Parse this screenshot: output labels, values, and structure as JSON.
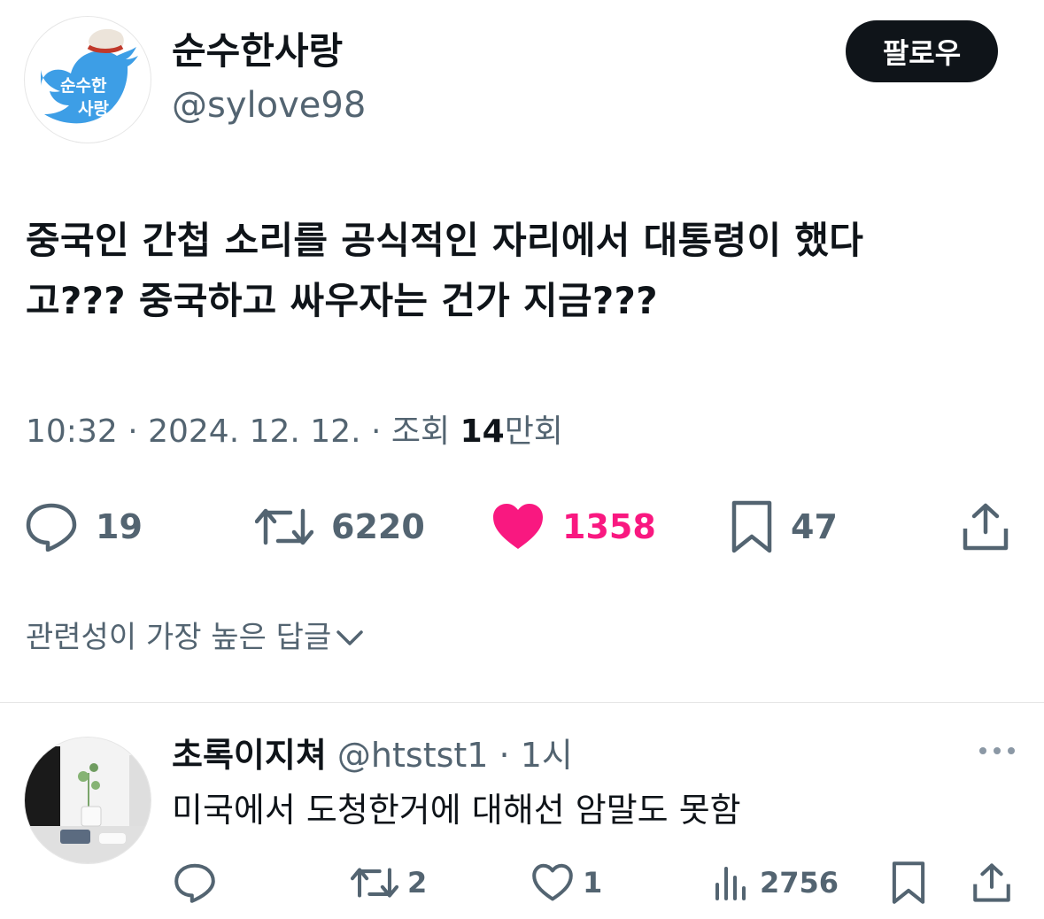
{
  "author": {
    "display_name": "순수한사랑",
    "handle": "@sylove98",
    "avatar_text_top": "순수한",
    "avatar_text_bottom": "사랑"
  },
  "follow_label": "팔로우",
  "tweet": {
    "line1": "중국인 간첩 소리를 공식적인 자리에서 대통령이 했다",
    "line2": "고??? 중국하고 싸우자는 건가 지금???"
  },
  "meta": {
    "time": "10:32",
    "sep1": " · ",
    "date": "2024. 12. 12.",
    "sep2": " · ",
    "views_label": "조회 ",
    "views_value": "14",
    "views_unit": "만회"
  },
  "actions": {
    "replies": "19",
    "retweets": "6220",
    "likes": "1358",
    "bookmarks": "47"
  },
  "sort_label": "관련성이 가장 높은 답글",
  "reply": {
    "name": "초록이지쳐",
    "handle": "@htstst1",
    "time": "1시",
    "sep": " · ",
    "text": "미국에서 도청한거에 대해선 암말도 못함",
    "retweets": "2",
    "likes": "1",
    "views": "2756"
  },
  "colors": {
    "text": "#0f1419",
    "secondary": "#536471",
    "like": "#f91880",
    "follow_bg": "#0f1419",
    "divider": "#e6e6e6"
  }
}
